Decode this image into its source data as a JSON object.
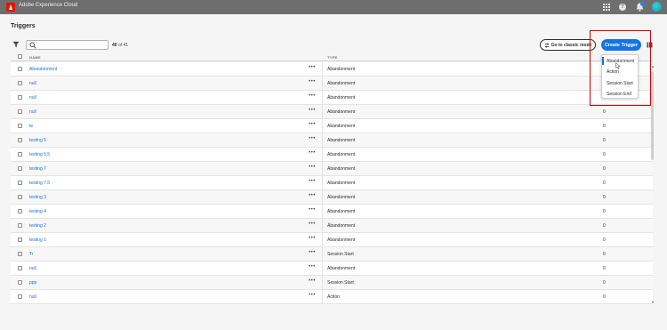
{
  "app": {
    "title": "Adobe Experience Cloud"
  },
  "page": {
    "title": "Triggers"
  },
  "toolbar": {
    "search_placeholder": "",
    "count_shown": "40",
    "count_total": "of 41",
    "classic_label": "Go to classic mode",
    "create_label": "Create Trigger"
  },
  "table": {
    "headers": {
      "name": "NAME",
      "type": "TYPE"
    },
    "rows": [
      {
        "name": "Abandonment",
        "type": "Abandonment",
        "num": ""
      },
      {
        "name": "null",
        "type": "Abandonment",
        "num": ""
      },
      {
        "name": "null",
        "type": "Abandonment",
        "num": "0"
      },
      {
        "name": "null",
        "type": "Abandonment",
        "num": "0"
      },
      {
        "name": "te",
        "type": "Abandonment",
        "num": "0"
      },
      {
        "name": "testing 5",
        "type": "Abandonment",
        "num": "0"
      },
      {
        "name": "testing 5.5",
        "type": "Abandonment",
        "num": "0"
      },
      {
        "name": "testing 7",
        "type": "Abandonment",
        "num": "0"
      },
      {
        "name": "testing 7.5",
        "type": "Abandonment",
        "num": "0"
      },
      {
        "name": "testing 3",
        "type": "Abandonment",
        "num": "0"
      },
      {
        "name": "testing 4",
        "type": "Abandonment",
        "num": "0"
      },
      {
        "name": "testing 2",
        "type": "Abandonment",
        "num": "0"
      },
      {
        "name": "testing 1",
        "type": "Abandonment",
        "num": "0"
      },
      {
        "name": "Tr",
        "type": "Session Start",
        "num": "0"
      },
      {
        "name": "null",
        "type": "Abandonment",
        "num": "0"
      },
      {
        "name": "ppp",
        "type": "Session Start",
        "num": "0"
      },
      {
        "name": "null",
        "type": "Action",
        "num": "0"
      }
    ]
  },
  "dropdown": {
    "items": [
      "Abandonment",
      "Action",
      "Session Start",
      "Session End"
    ]
  },
  "icons": {
    "more": "more-options-icon",
    "filter": "filter-icon",
    "search": "search-icon",
    "grid": "apps-grid-icon",
    "help": "help-icon",
    "bell": "notifications-icon"
  },
  "colors": {
    "accent": "#1473e6",
    "topbar": "#6e6e6e",
    "brand": "#eb1000",
    "highlight": "#d40000"
  }
}
